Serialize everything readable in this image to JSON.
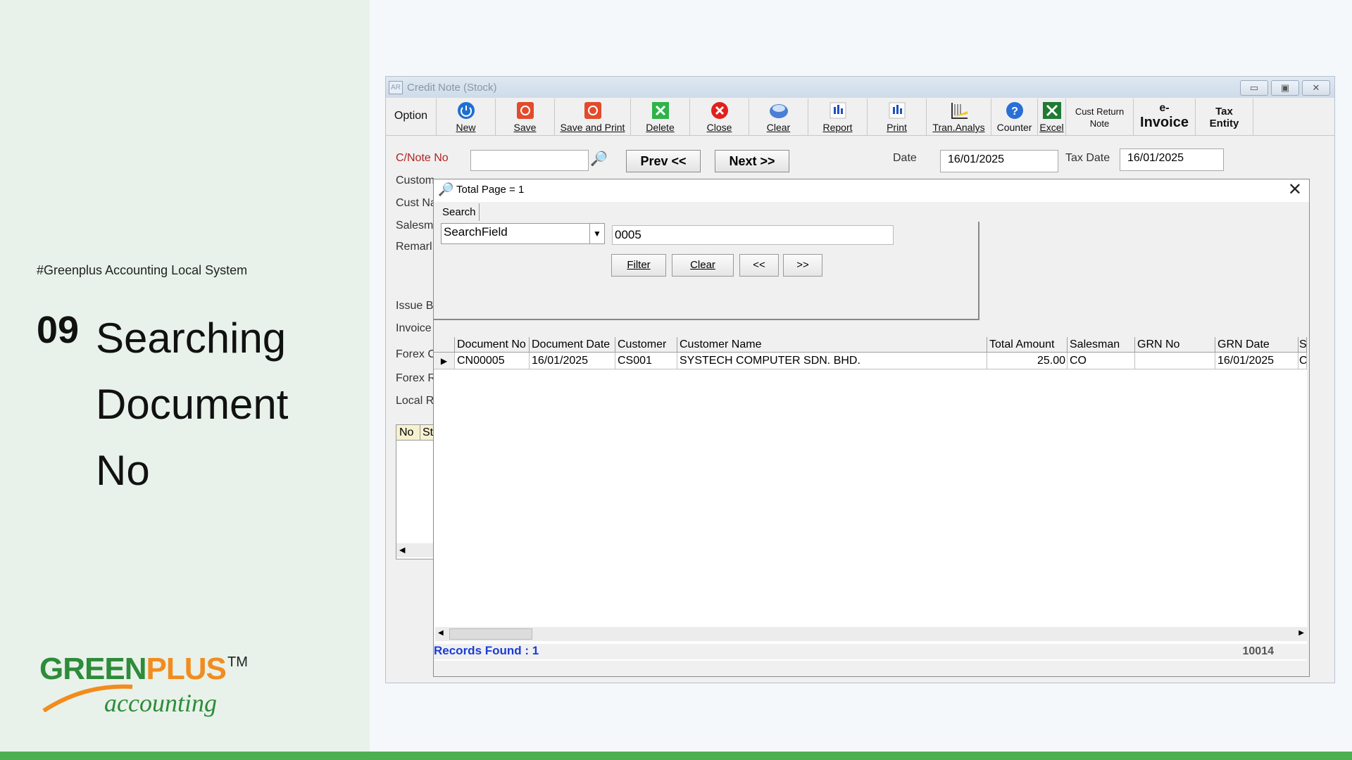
{
  "slide": {
    "hashtag": "#Greenplus Accounting Local System",
    "number": "09",
    "title_line1": "Searching",
    "title_line2": "Document",
    "title_line3": "No"
  },
  "logo": {
    "part1": "GREEN",
    "part2": "PLUS",
    "tm": "TM",
    "sub": "accounting"
  },
  "window": {
    "app_icon": "AR",
    "title": "Credit Note (Stock)",
    "toolbar": {
      "option": "Option",
      "new": "New",
      "save": "Save",
      "save_print": "Save and Print",
      "delete": "Delete",
      "close": "Close",
      "clear": "Clear",
      "report": "Report",
      "print": "Print",
      "tran_analys": "Tran.Analys",
      "counter": "Counter",
      "excel": "Excel",
      "cust_return_1": "Cust Return",
      "cust_return_2": "Note",
      "einvoice_1": "e-",
      "einvoice_2": "Invoice",
      "tax_1": "Tax",
      "tax_2": "Entity"
    },
    "form": {
      "cnote_label": "C/Note No",
      "prev": "Prev <<",
      "next": "Next >>",
      "date_label": "Date",
      "date_value": "16/01/2025",
      "tax_date_label": "Tax Date",
      "tax_date_value": "16/01/2025",
      "customer_label": "Custom",
      "cust_name_label": "Cust Na",
      "salesman_label": "Salesm",
      "remark_label": "Remarl",
      "issue_label": "Issue B",
      "invoice_label": "Invoice",
      "forex1_label": "Forex C",
      "forex2_label": "Forex R",
      "local_label": "Local R",
      "grid_no": "No",
      "grid_s": "St"
    }
  },
  "dialog": {
    "title": "Total Page = 1",
    "tab": "Search",
    "search_field": "SearchField",
    "search_value": "0005",
    "filter": "Filter",
    "clear": "Clear",
    "prev": "<<",
    "next": ">>",
    "columns": [
      "Document No",
      "Document Date",
      "Customer",
      "Customer Name",
      "Total Amount",
      "Salesman",
      "GRN No",
      "GRN Date",
      "S"
    ],
    "rows": [
      [
        "CN00005",
        "16/01/2025",
        "CS001",
        "SYSTECH COMPUTER SDN. BHD.",
        "25.00",
        "CO",
        "",
        "16/01/2025",
        "C"
      ]
    ],
    "records_found": "Records Found : 1",
    "code": "10014"
  },
  "colors": {
    "accent_green": "#2e8b3a",
    "accent_orange": "#f28c1e",
    "records_blue": "#1a3cd6",
    "cnote_red": "#b22222"
  }
}
